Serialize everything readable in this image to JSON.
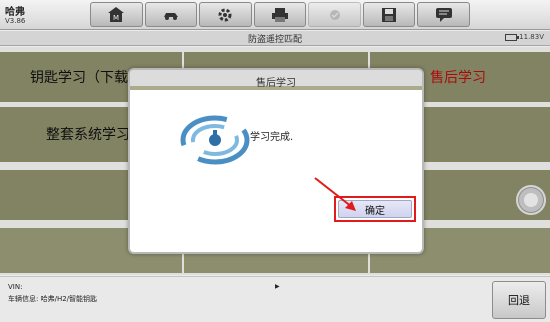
{
  "header": {
    "brand": "哈弗",
    "version": "V3.86",
    "toolbar": [
      {
        "icon": "home-icon"
      },
      {
        "icon": "vehicle-icon"
      },
      {
        "icon": "gear-icon"
      },
      {
        "icon": "printer-icon"
      },
      {
        "icon": "settings-disabled-icon"
      },
      {
        "icon": "save-icon"
      },
      {
        "icon": "message-icon"
      }
    ]
  },
  "subheader": {
    "title": "防盗遥控匹配",
    "battery": "11.83V"
  },
  "menu": {
    "item1": "钥匙学习（下载",
    "item2": "整套系统学习",
    "item3": "售后学习"
  },
  "dialog": {
    "title": "售后学习",
    "message": "学习完成.",
    "ok_label": "确定"
  },
  "footer": {
    "vin_label": "VIN:",
    "vehicle_info": "车辆信息: 哈弗/H2/智能钥匙",
    "marker": "▶",
    "back_label": "回退"
  },
  "colors": {
    "row_olive": "#8e8f6c",
    "highlight_red": "#e01b1b",
    "menu_red": "#b80d0d"
  }
}
